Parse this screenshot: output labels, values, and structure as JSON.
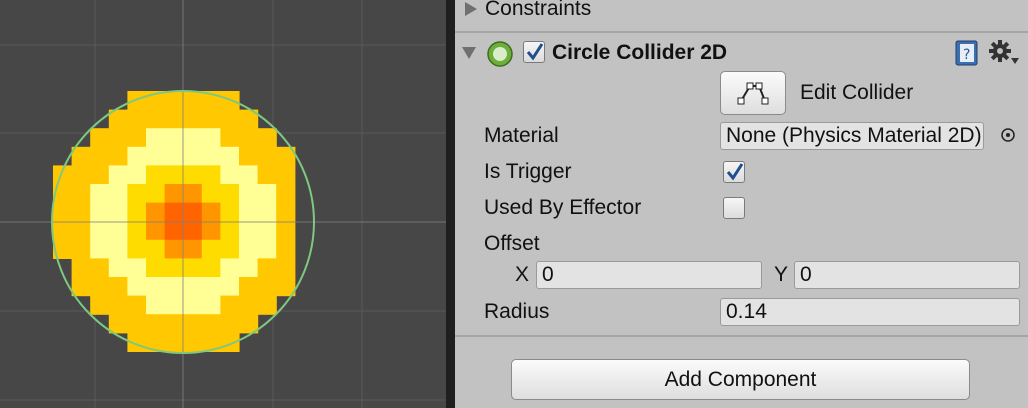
{
  "scene": {
    "background": "#474747",
    "grid_color": "#5a5a5a",
    "axis_color": "#808080",
    "collider_color": "#7fc87f",
    "palette": {
      "outer": "#ffc800",
      "light": "#ffff96",
      "mid": "#ffdc00",
      "inner": "#ff9600",
      "core": "#ff6400"
    }
  },
  "inspector": {
    "constraints_label": "Constraints",
    "component": {
      "title": "Circle Collider 2D",
      "enabled": true,
      "edit_collider_label": "Edit Collider",
      "properties": {
        "material_label": "Material",
        "material_value": "None (Physics Material 2D)",
        "is_trigger_label": "Is Trigger",
        "is_trigger": true,
        "used_by_effector_label": "Used By Effector",
        "used_by_effector": false,
        "offset_label": "Offset",
        "offset_x_label": "X",
        "offset_x": "0",
        "offset_y_label": "Y",
        "offset_y": "0",
        "radius_label": "Radius",
        "radius": "0.14"
      }
    },
    "add_component_label": "Add Component"
  }
}
